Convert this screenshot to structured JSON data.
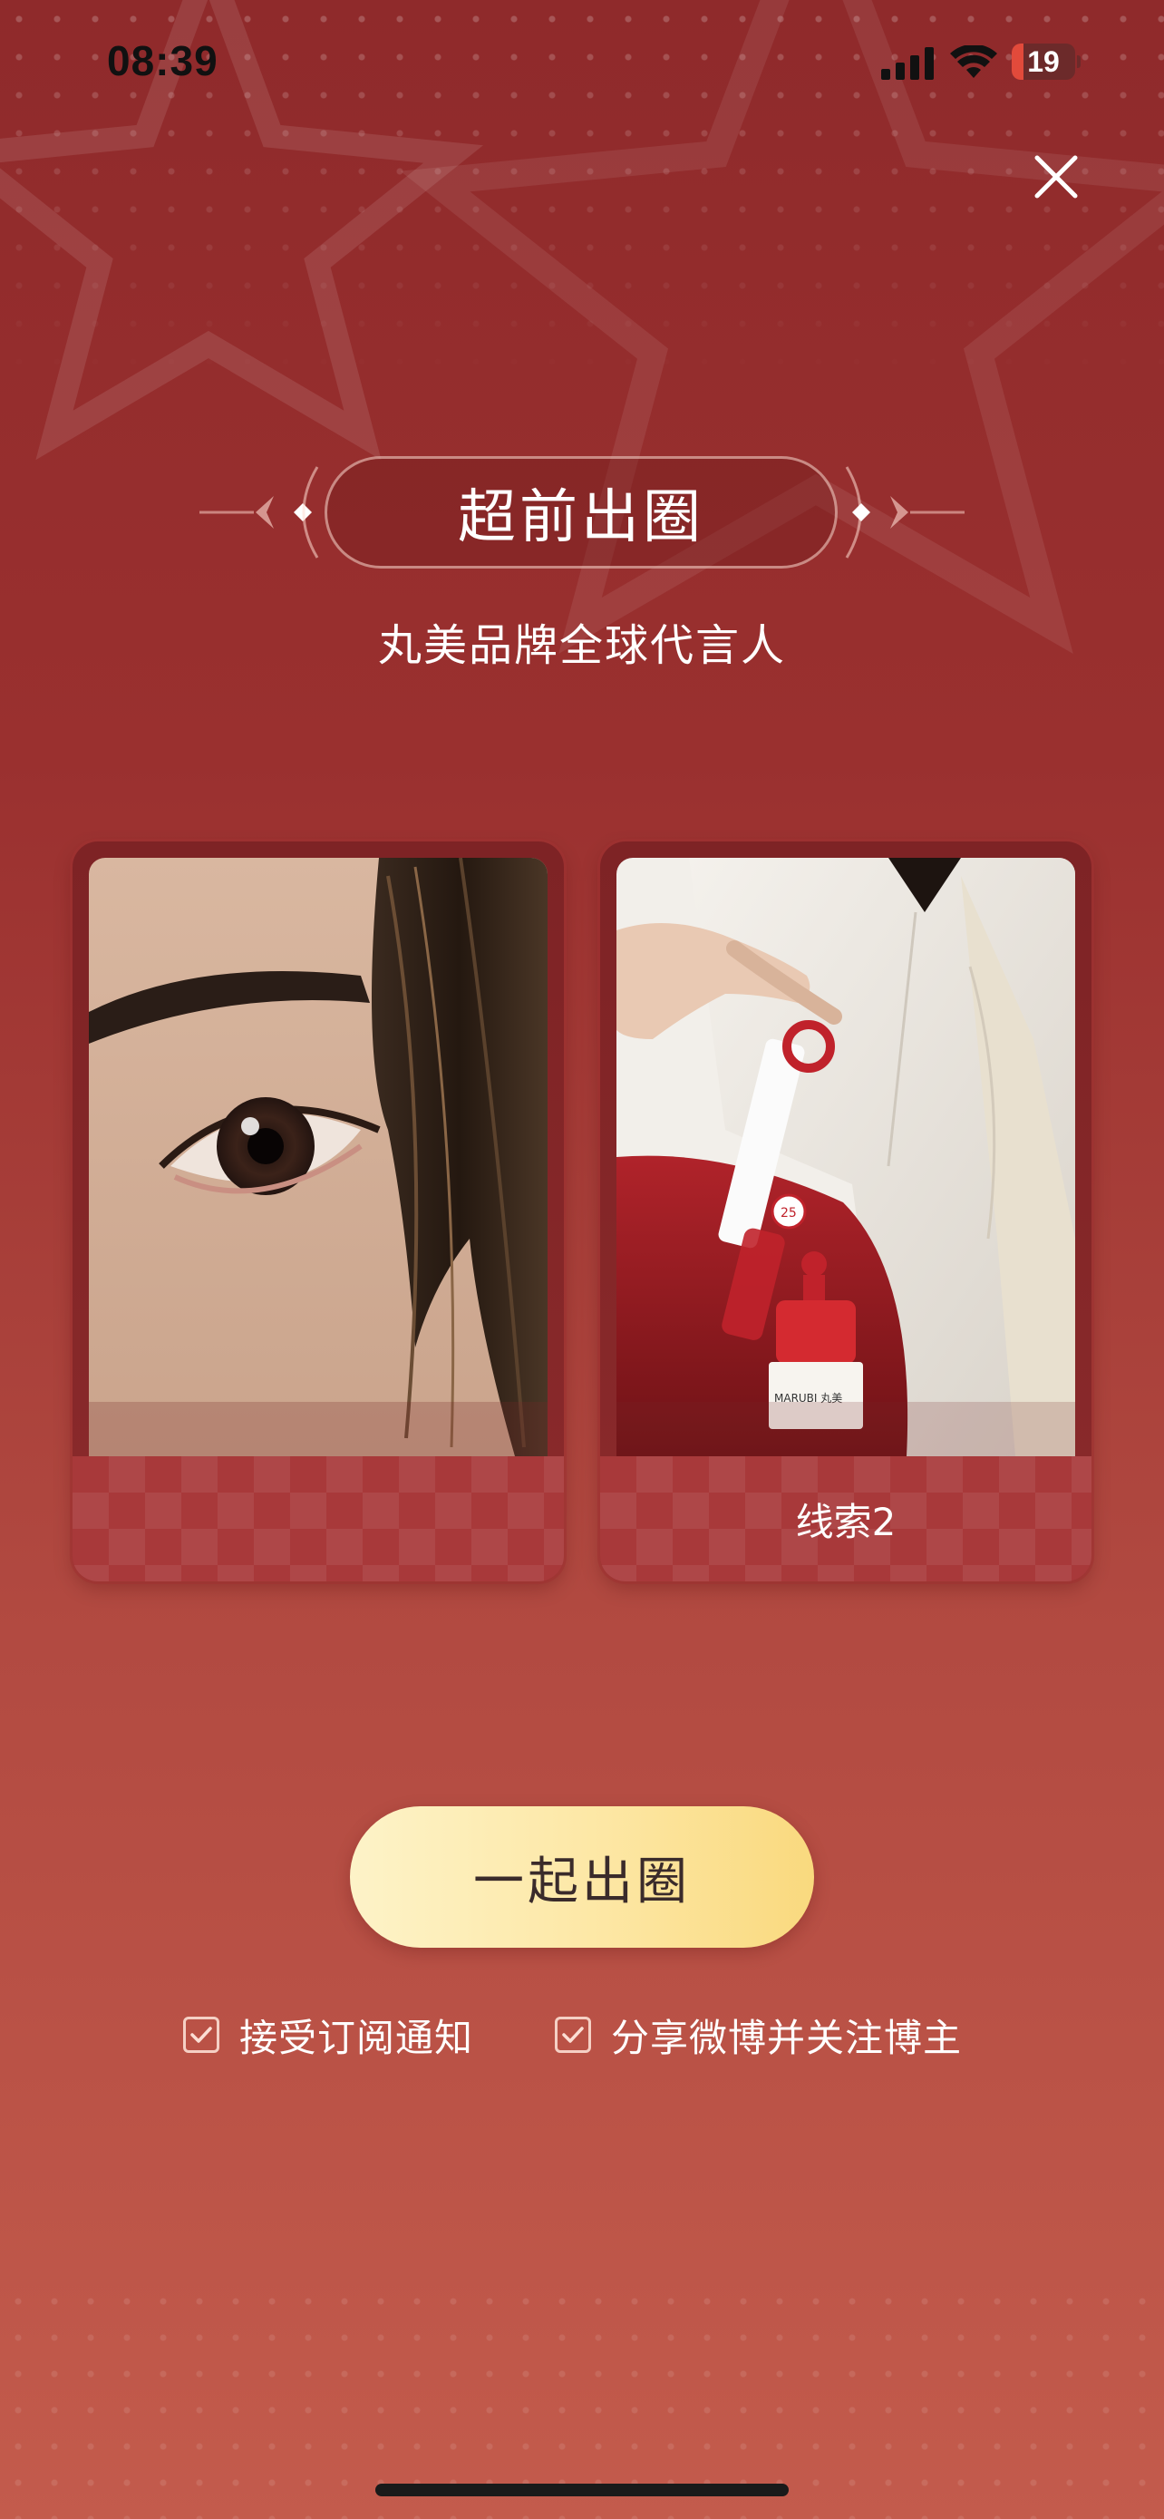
{
  "status_bar": {
    "time": "08:39",
    "battery_level": "19",
    "battery_fraction": 0.19
  },
  "title": "超前出圈",
  "subtitle": "丸美品牌全球代言人",
  "cards": [
    {
      "label": ""
    },
    {
      "label": "线索2"
    }
  ],
  "cta_label": "一起出圈",
  "checkboxes": [
    {
      "label": "接受订阅通知",
      "checked": true
    },
    {
      "label": "分享微博并关注博主",
      "checked": true
    }
  ],
  "product_text": {
    "brand": "MARUBI 丸美",
    "badge": "25"
  },
  "colors": {
    "accent_red": "#9a302f",
    "cta_gold": "#fde7a4"
  }
}
